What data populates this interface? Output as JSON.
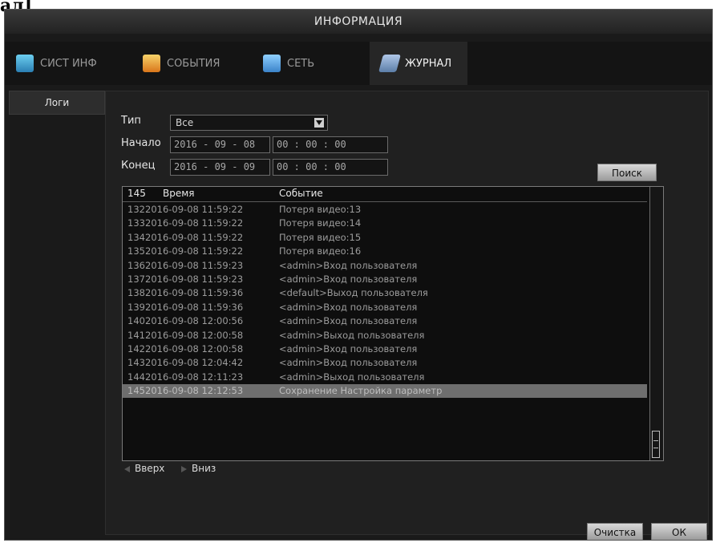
{
  "page_fragment": "ал]",
  "window": {
    "title": "ИНФОРМАЦИЯ"
  },
  "tabs": [
    {
      "label": "СИСТ ИНФ",
      "icon": "monitor-icon",
      "active": false
    },
    {
      "label": "СОБЫТИЯ",
      "icon": "events-folder-icon",
      "active": false
    },
    {
      "label": "СЕТЬ",
      "icon": "network-icon",
      "active": false
    },
    {
      "label": "ЖУРНАЛ",
      "icon": "journal-icon",
      "active": true
    }
  ],
  "side_tab": {
    "label": "Логи"
  },
  "filters": {
    "type_label": "Тип",
    "type_value": "Все",
    "start_label": "Начало",
    "start_date": "2016 - 09 - 08",
    "start_time": "00 : 00 : 00",
    "end_label": "Конец",
    "end_date": "2016 - 09 - 09",
    "end_time": "00 : 00 : 00"
  },
  "buttons": {
    "search": "Поиск",
    "clear": "Очистка",
    "ok": "ОК"
  },
  "log_table": {
    "count": "145",
    "col_time": "Время",
    "col_event": "Событие",
    "rows": [
      {
        "n": "132",
        "time": "2016-09-08 11:59:22",
        "event": "Потеря видео:13"
      },
      {
        "n": "133",
        "time": "2016-09-08 11:59:22",
        "event": "Потеря видео:14"
      },
      {
        "n": "134",
        "time": "2016-09-08 11:59:22",
        "event": "Потеря видео:15"
      },
      {
        "n": "135",
        "time": "2016-09-08 11:59:22",
        "event": "Потеря видео:16"
      },
      {
        "n": "136",
        "time": "2016-09-08 11:59:23",
        "event": "<admin>Вход пользователя"
      },
      {
        "n": "137",
        "time": "2016-09-08 11:59:23",
        "event": "<admin>Вход пользователя"
      },
      {
        "n": "138",
        "time": "2016-09-08 11:59:36",
        "event": "<default>Выход пользователя"
      },
      {
        "n": "139",
        "time": "2016-09-08 11:59:36",
        "event": "<admin>Вход пользователя"
      },
      {
        "n": "140",
        "time": "2016-09-08 12:00:56",
        "event": "<admin>Вход пользователя"
      },
      {
        "n": "141",
        "time": "2016-09-08 12:00:58",
        "event": "<admin>Выход пользователя"
      },
      {
        "n": "142",
        "time": "2016-09-08 12:00:58",
        "event": "<admin>Вход пользователя"
      },
      {
        "n": "143",
        "time": "2016-09-08 12:04:42",
        "event": "<admin>Вход пользователя"
      },
      {
        "n": "144",
        "time": "2016-09-08 12:11:23",
        "event": "<admin>Выход пользователя"
      },
      {
        "n": "145",
        "time": "2016-09-08 12:12:53",
        "event": "Сохранение Настройка параметр"
      }
    ]
  },
  "pager": {
    "up": "Вверх",
    "down": "Вниз"
  }
}
